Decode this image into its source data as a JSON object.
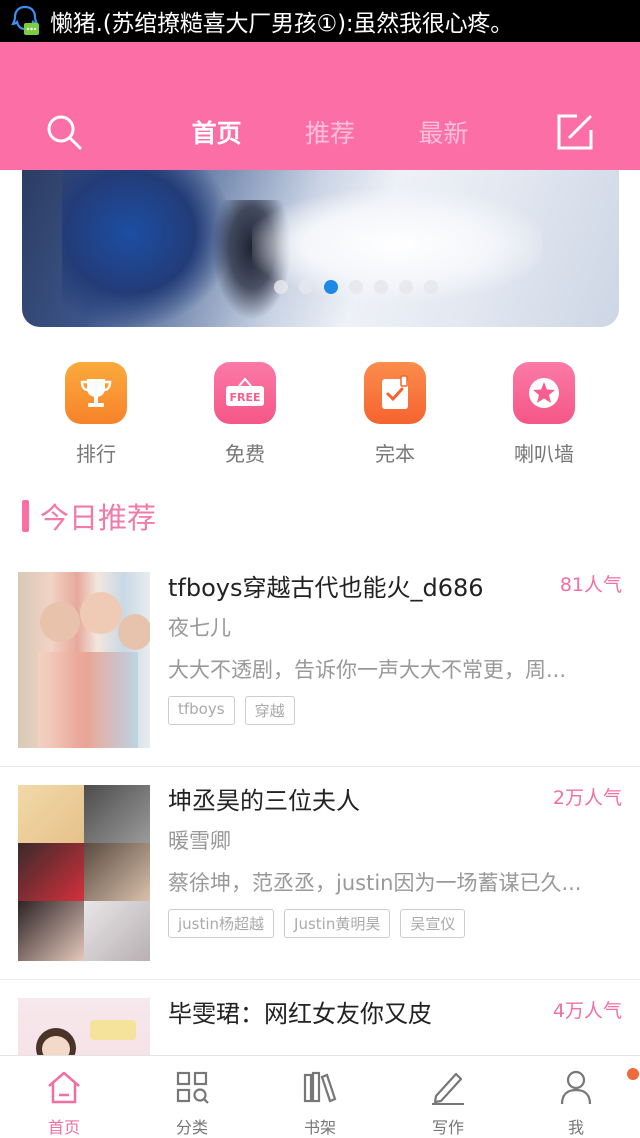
{
  "statusbar": {
    "notification_icon": "qq-message-icon",
    "notification_text": "懒猪.(苏绾撩糙喜大厂男孩①):虽然我很心疼。"
  },
  "header": {
    "tabs": [
      {
        "label": "首页",
        "active": true
      },
      {
        "label": "推荐",
        "active": false
      },
      {
        "label": "最新",
        "active": false
      }
    ],
    "search_icon": "search-icon",
    "edit_icon": "edit-icon"
  },
  "banner": {
    "dot_count": 7,
    "active_dot": 3
  },
  "quick_entries": [
    {
      "label": "排行",
      "icon": "trophy-icon",
      "color": "#f88a2a"
    },
    {
      "label": "免费",
      "icon": "free-sign-icon",
      "color": "#f75f90"
    },
    {
      "label": "完本",
      "icon": "checklist-icon",
      "color": "#f8733c"
    },
    {
      "label": "喇叭墙",
      "icon": "star-icon",
      "color": "#f75f90"
    }
  ],
  "section": {
    "title": "今日推荐"
  },
  "books": [
    {
      "title": "tfboys穿越古代也能火_d686",
      "popularity": "81人气",
      "author": "夜七儿",
      "desc": "大大不透剧，告诉你一声大大不常更，周...",
      "tags": [
        "tfboys",
        "穿越"
      ]
    },
    {
      "title": "坤丞昊的三位夫人",
      "popularity": "2万人气",
      "author": "暖雪卿",
      "desc": "蔡徐坤，范丞丞，justin因为一场蓄谋已久...",
      "tags": [
        "justin杨超越",
        "Justin黄明昊",
        "吴宣仪"
      ]
    },
    {
      "title": "毕雯珺：网红女友你又皮",
      "popularity": "4万人气"
    }
  ],
  "bottom_nav": [
    {
      "label": "首页",
      "icon": "home-icon",
      "active": true
    },
    {
      "label": "分类",
      "icon": "category-icon",
      "active": false
    },
    {
      "label": "书架",
      "icon": "bookshelf-icon",
      "active": false
    },
    {
      "label": "写作",
      "icon": "pencil-icon",
      "active": false
    },
    {
      "label": "我",
      "icon": "user-icon",
      "active": false
    }
  ],
  "colors": {
    "brand_pink": "#fb6fa6",
    "accent_pink": "#f06fa4",
    "active_dot": "#1e88e5"
  }
}
